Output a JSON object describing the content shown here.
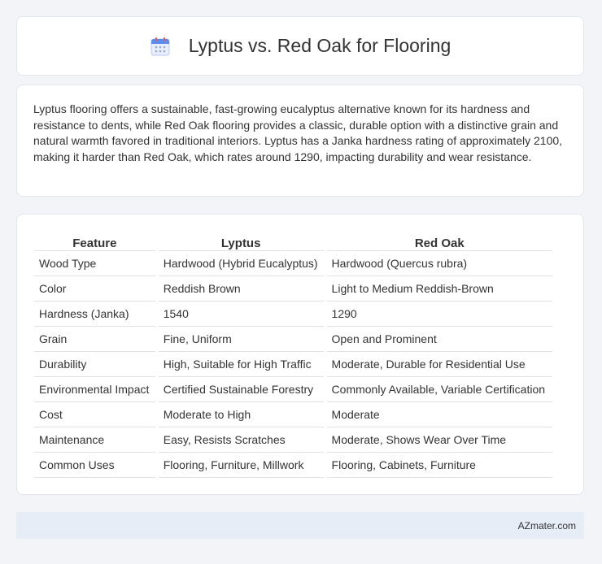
{
  "header": {
    "title": "Lyptus vs. Red Oak for Flooring",
    "icon": "calendar-icon",
    "accent_color": "#5b8def"
  },
  "summary": {
    "text": "Lyptus flooring offers a sustainable, fast-growing eucalyptus alternative known for its hardness and resistance to dents, while Red Oak flooring provides a classic, durable option with a distinctive grain and natural warmth favored in traditional interiors. Lyptus has a Janka hardness rating of approximately 2100, making it harder than Red Oak, which rates around 1290, impacting durability and wear resistance."
  },
  "table": {
    "headers": [
      "Feature",
      "Lyptus",
      "Red Oak"
    ],
    "rows": [
      [
        "Wood Type",
        "Hardwood (Hybrid Eucalyptus)",
        "Hardwood (Quercus rubra)"
      ],
      [
        "Color",
        "Reddish Brown",
        "Light to Medium Reddish-Brown"
      ],
      [
        "Hardness (Janka)",
        "1540",
        "1290"
      ],
      [
        "Grain",
        "Fine, Uniform",
        "Open and Prominent"
      ],
      [
        "Durability",
        "High, Suitable for High Traffic",
        "Moderate, Durable for Residential Use"
      ],
      [
        "Environmental Impact",
        "Certified Sustainable Forestry",
        "Commonly Available, Variable Certification"
      ],
      [
        "Cost",
        "Moderate to High",
        "Moderate"
      ],
      [
        "Maintenance",
        "Easy, Resists Scratches",
        "Moderate, Shows Wear Over Time"
      ],
      [
        "Common Uses",
        "Flooring, Furniture, Millwork",
        "Flooring, Cabinets, Furniture"
      ]
    ]
  },
  "footer": {
    "text": "AZmater.com"
  }
}
